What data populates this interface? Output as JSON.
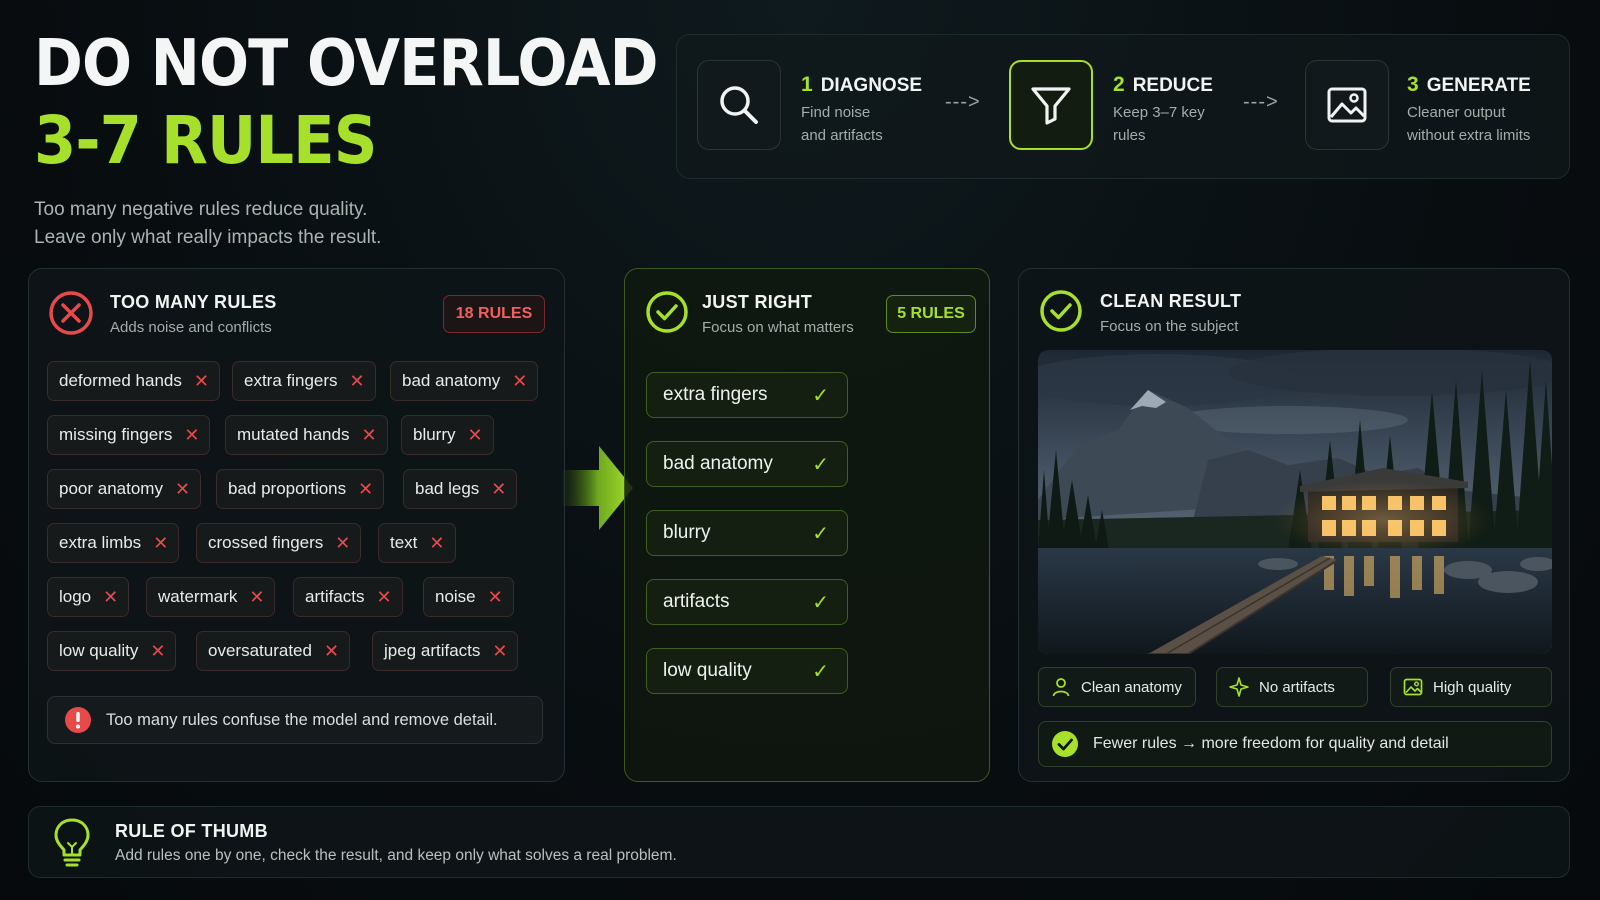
{
  "header": {
    "title_line1": "DO NOT OVERLOAD",
    "title_line2": "3-7 RULES",
    "subtitle_line1": "Too many negative rules reduce quality.",
    "subtitle_line2": "Leave only what really impacts the result."
  },
  "steps": [
    {
      "num": "1",
      "title": "DIAGNOSE",
      "desc_line1": "Find noise",
      "desc_line2": "and artifacts",
      "icon": "search-icon"
    },
    {
      "num": "2",
      "title": "REDUCE",
      "desc_line1": "Keep 3–7 key",
      "desc_line2": "rules",
      "icon": "filter-icon"
    },
    {
      "num": "3",
      "title": "GENERATE",
      "desc_line1": "Cleaner output",
      "desc_line2": "without extra limits",
      "icon": "image-icon"
    }
  ],
  "step_arrow": "--->",
  "too_many": {
    "title": "TOO MANY RULES",
    "subtitle": "Adds noise and conflicts",
    "badge": "18 RULES",
    "chips": [
      "deformed hands",
      "extra fingers",
      "bad anatomy",
      "missing fingers",
      "mutated hands",
      "blurry",
      "poor anatomy",
      "bad proportions",
      "bad legs",
      "extra limbs",
      "crossed fingers",
      "text",
      "logo",
      "watermark",
      "artifacts",
      "noise",
      "low quality",
      "oversaturated",
      "jpeg artifacts"
    ],
    "remove_glyph": "✕",
    "warning": "Too many rules confuse the model and remove detail."
  },
  "just_right": {
    "title": "JUST RIGHT",
    "subtitle": "Focus on what matters",
    "badge": "5 RULES",
    "rules": [
      "extra fingers",
      "bad anatomy",
      "blurry",
      "artifacts",
      "low quality"
    ],
    "check_glyph": "✓"
  },
  "clean_result": {
    "title": "CLEAN RESULT",
    "subtitle": "Focus on the subject",
    "features": [
      {
        "label": "Clean anatomy",
        "icon": "person-icon"
      },
      {
        "label": "No artifacts",
        "icon": "sparkle-icon"
      },
      {
        "label": "High quality",
        "icon": "image-icon"
      }
    ],
    "summary": "Fewer rules → more freedom for quality and detail"
  },
  "tip": {
    "title": "RULE OF THUMB",
    "text": "Add rules one by one, check the result, and keep only what solves a real problem."
  },
  "colors": {
    "accent": "#a6e02a",
    "danger": "#e84a4a",
    "background": "#080d10"
  }
}
